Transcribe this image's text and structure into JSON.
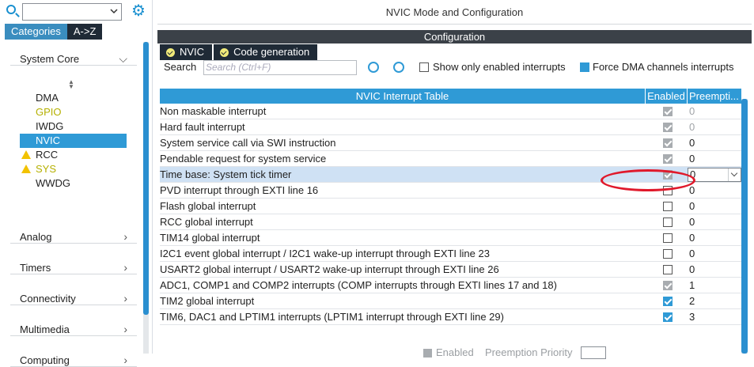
{
  "left": {
    "search_value": "",
    "tabs": [
      "Categories",
      "A->Z"
    ],
    "groups": [
      {
        "label": "System Core"
      },
      {
        "label": "Analog"
      },
      {
        "label": "Timers"
      },
      {
        "label": "Connectivity"
      },
      {
        "label": "Multimedia"
      },
      {
        "label": "Computing"
      }
    ],
    "system_core_items": [
      {
        "label": "DMA"
      },
      {
        "label": "GPIO"
      },
      {
        "label": "IWDG"
      },
      {
        "label": "NVIC"
      },
      {
        "label": "RCC"
      },
      {
        "label": "SYS"
      },
      {
        "label": "WWDG"
      }
    ]
  },
  "right": {
    "title": "NVIC Mode and Configuration",
    "config_label": "Configuration",
    "tabs": [
      "NVIC",
      "Code generation"
    ],
    "search_label": "Search",
    "search_placeholder": "Search (Ctrl+F)",
    "show_only_enabled_label": "Show only enabled interrupts",
    "force_dma_label": "Force DMA channels interrupts",
    "table_header": {
      "name": "NVIC Interrupt Table",
      "enabled": "Enabled",
      "preemption": "Preempti..."
    },
    "rows": [
      {
        "name": "Non maskable interrupt",
        "enabled": "disabled-checked",
        "pre": "0"
      },
      {
        "name": "Hard fault interrupt",
        "enabled": "disabled-checked",
        "pre": "0"
      },
      {
        "name": "System service call via SWI instruction",
        "enabled": "disabled-checked",
        "pre": "0"
      },
      {
        "name": "Pendable request for system service",
        "enabled": "disabled-checked",
        "pre": "0"
      },
      {
        "name": "Time base: System tick timer",
        "enabled": "disabled-checked",
        "pre": "0"
      },
      {
        "name": "PVD interrupt through EXTI line 16",
        "enabled": "unchecked",
        "pre": "0"
      },
      {
        "name": "Flash global interrupt",
        "enabled": "unchecked",
        "pre": "0"
      },
      {
        "name": "RCC global interrupt",
        "enabled": "unchecked",
        "pre": "0"
      },
      {
        "name": "TIM14 global interrupt",
        "enabled": "unchecked",
        "pre": "0"
      },
      {
        "name": "I2C1 event global interrupt / I2C1 wake-up interrupt through EXTI line 23",
        "enabled": "unchecked",
        "pre": "0"
      },
      {
        "name": "USART2 global interrupt / USART2 wake-up interrupt through EXTI line 26",
        "enabled": "unchecked",
        "pre": "0"
      },
      {
        "name": "ADC1, COMP1 and COMP2 interrupts (COMP interrupts through EXTI lines 17 and 18)",
        "enabled": "disabled-checked",
        "pre": "1"
      },
      {
        "name": "TIM2 global interrupt",
        "enabled": "checked",
        "pre": "2"
      },
      {
        "name": "TIM6, DAC1 and LPTIM1 interrupts (LPTIM1 interrupt through EXTI line 29)",
        "enabled": "checked",
        "pre": "3"
      }
    ],
    "bottom": {
      "enabled_label": "Enabled",
      "preemption_label": "Preemption Priority"
    }
  },
  "colors": {
    "accent": "#2f9ad6",
    "dark_tab": "#1f2a36",
    "highlight_row": "#cfe1f4",
    "annotation": "#e0192b"
  }
}
